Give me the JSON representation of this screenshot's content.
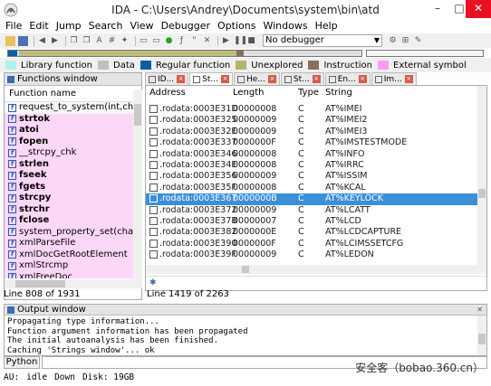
{
  "window": {
    "title": "IDA - C:\\Users\\Andrey\\Documents\\system\\bin\\atd",
    "minimize": "–",
    "maximize": "□",
    "close": "✕"
  },
  "menu": [
    "File",
    "Edit",
    "Jump",
    "Search",
    "View",
    "Debugger",
    "Options",
    "Windows",
    "Help"
  ],
  "toolbar": {
    "debugger_value": "No debugger"
  },
  "legend": [
    {
      "label": "Library function",
      "color": "#b0f0f0"
    },
    {
      "label": "Data",
      "color": "#c0c0c0"
    },
    {
      "label": "Regular function",
      "color": "#0a5ea8"
    },
    {
      "label": "Unexplored",
      "color": "#b5b56a"
    },
    {
      "label": "Instruction",
      "color": "#8a6e5a"
    },
    {
      "label": "External symbol",
      "color": "#ff9cf0"
    }
  ],
  "functions_window": {
    "title": "Functions window",
    "column": "Function name",
    "items": [
      {
        "name": "request_to_system(int,char const",
        "style": "lib"
      },
      {
        "name": "strtok",
        "style": "ext-bold"
      },
      {
        "name": "atoi",
        "style": "ext-bold"
      },
      {
        "name": "fopen",
        "style": "ext-bold"
      },
      {
        "name": "__strcpy_chk",
        "style": "ext"
      },
      {
        "name": "strlen",
        "style": "ext-bold"
      },
      {
        "name": "fseek",
        "style": "ext-bold"
      },
      {
        "name": "fgets",
        "style": "ext-bold"
      },
      {
        "name": "strcpy",
        "style": "ext-bold"
      },
      {
        "name": "strchr",
        "style": "ext-bold"
      },
      {
        "name": "fclose",
        "style": "ext-bold"
      },
      {
        "name": "system_property_set(char const",
        "style": "ext"
      },
      {
        "name": "xmlParseFile",
        "style": "ext"
      },
      {
        "name": "xmlDocGetRootElement",
        "style": "ext"
      },
      {
        "name": "xmlStrcmp",
        "style": "ext"
      },
      {
        "name": "xmlFreeDoc",
        "style": "ext"
      }
    ],
    "status": "Line 808 of 1931"
  },
  "tabs": [
    {
      "label": "ID...",
      "close": "×",
      "active": false
    },
    {
      "label": "St...",
      "close": "×",
      "active": true
    },
    {
      "label": "He...",
      "close": "×",
      "active": false
    },
    {
      "label": "St...",
      "close": "×",
      "active": false
    },
    {
      "label": "En...",
      "close": "×",
      "active": false
    },
    {
      "label": "Im...",
      "close": "×",
      "active": false
    }
  ],
  "strings_window": {
    "columns": [
      "Address",
      "Length",
      "Type",
      "String"
    ],
    "rows": [
      [
        ".rodata:0003E31D",
        "00000008",
        "C",
        "AT%IMEI"
      ],
      [
        ".rodata:0003E325",
        "00000009",
        "C",
        "AT%IMEI2"
      ],
      [
        ".rodata:0003E32E",
        "00000009",
        "C",
        "AT%IMEI3"
      ],
      [
        ".rodata:0003E337",
        "0000000F",
        "C",
        "AT%IMSTESTMODE"
      ],
      [
        ".rodata:0003E346",
        "00000008",
        "C",
        "AT%INFO"
      ],
      [
        ".rodata:0003E34E",
        "00000008",
        "C",
        "AT%IRRC"
      ],
      [
        ".rodata:0003E356",
        "00000009",
        "C",
        "AT%ISSIM"
      ],
      [
        ".rodata:0003E35F",
        "00000008",
        "C",
        "AT%KCAL"
      ],
      [
        ".rodata:0003E367",
        "0000000B",
        "C",
        "AT%KEYLOCK"
      ],
      [
        ".rodata:0003E372",
        "00000009",
        "C",
        "AT%LCATT"
      ],
      [
        ".rodata:0003E37B",
        "00000007",
        "C",
        "AT%LCD"
      ],
      [
        ".rodata:0003E382",
        "0000000E",
        "C",
        "AT%LCDCAPTURE"
      ],
      [
        ".rodata:0003E390",
        "0000000F",
        "C",
        "AT%LCIMSSETCFG"
      ],
      [
        ".rodata:0003E39F",
        "00000009",
        "C",
        "AT%LEDON"
      ]
    ],
    "selected_row": 8,
    "status": "Line 1419 of 2263"
  },
  "output_window": {
    "title": "Output window",
    "lines": [
      "Propagating type information...",
      "Function argument information has been propagated",
      "The initial autoanalysis has been finished.",
      "Caching 'Strings window'... ok"
    ]
  },
  "cmdline": {
    "button": "Python"
  },
  "statusbar": {
    "au_label": "AU:",
    "au_state": "idle",
    "direction": "Down",
    "disk": "Disk: 19GB"
  },
  "watermark": "安全客（bobao.360.cn）"
}
